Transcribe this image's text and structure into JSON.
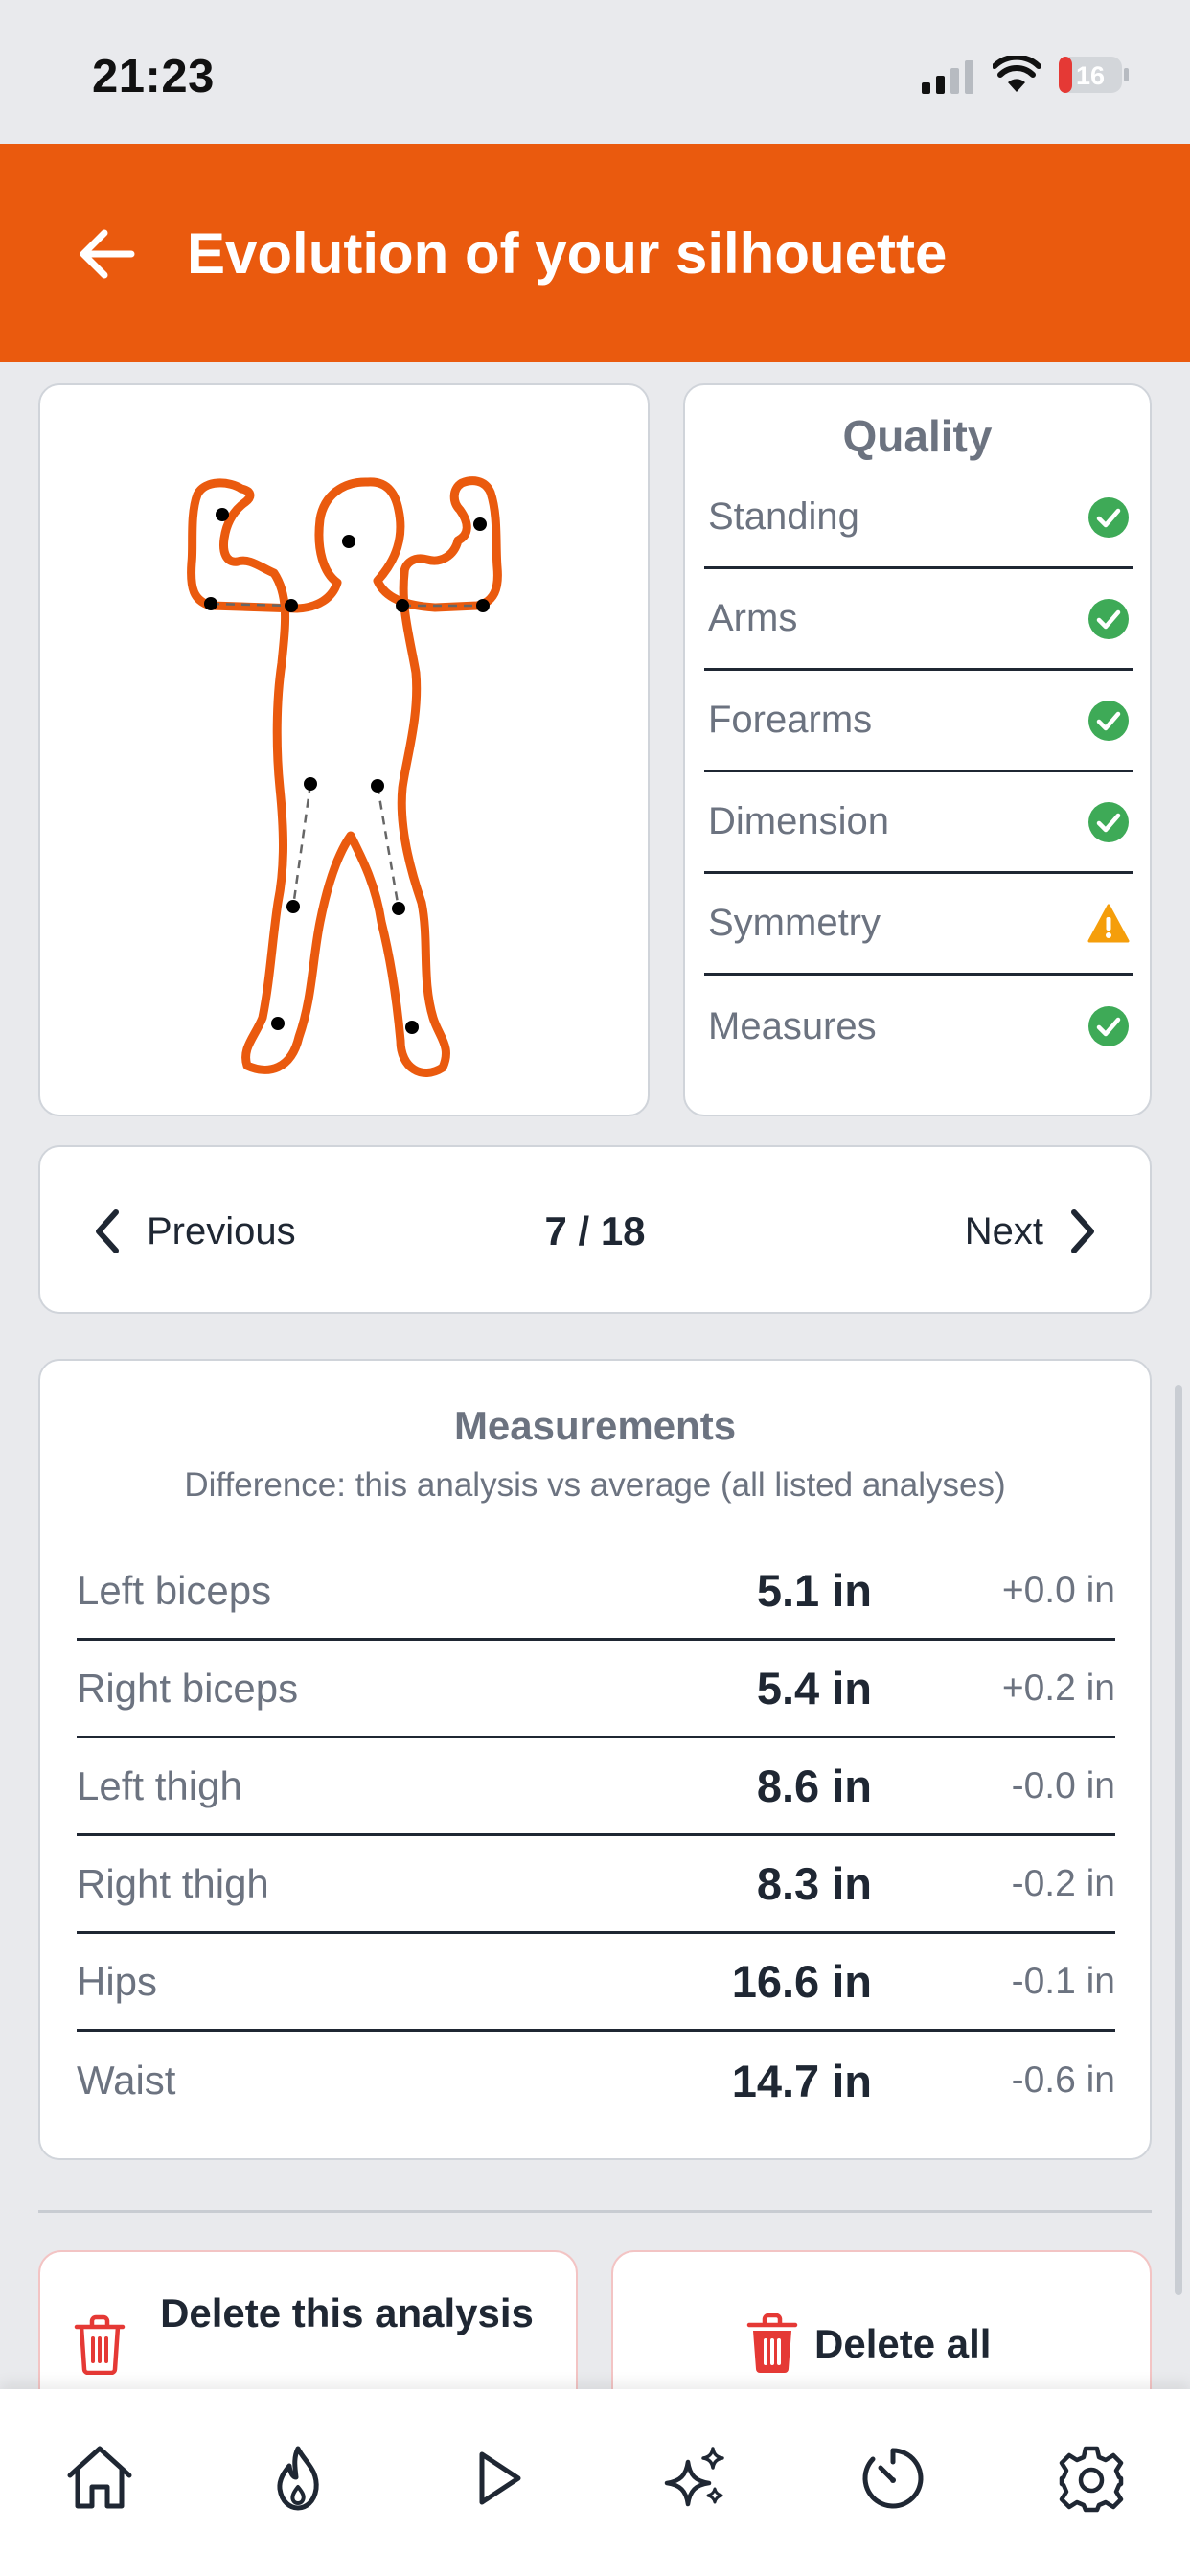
{
  "status_bar": {
    "time": "21:23",
    "battery": "16"
  },
  "header": {
    "title": "Evolution of your silhouette"
  },
  "quality": {
    "title": "Quality",
    "items": [
      {
        "label": "Standing",
        "status": "ok"
      },
      {
        "label": "Arms",
        "status": "ok"
      },
      {
        "label": "Forearms",
        "status": "ok"
      },
      {
        "label": "Dimension",
        "status": "ok"
      },
      {
        "label": "Symmetry",
        "status": "warning"
      },
      {
        "label": "Measures",
        "status": "ok"
      }
    ]
  },
  "pager": {
    "previous": "Previous",
    "count": "7 / 18",
    "next": "Next"
  },
  "measurements": {
    "title": "Measurements",
    "subtitle": "Difference: this analysis vs average (all listed analyses)",
    "rows": [
      {
        "label": "Left biceps",
        "value": "5.1 in",
        "diff": "+0.0 in"
      },
      {
        "label": "Right biceps",
        "value": "5.4 in",
        "diff": "+0.2 in"
      },
      {
        "label": "Left thigh",
        "value": "8.6 in",
        "diff": "-0.0 in"
      },
      {
        "label": "Right thigh",
        "value": "8.3 in",
        "diff": "-0.2 in"
      },
      {
        "label": "Hips",
        "value": "16.6 in",
        "diff": "-0.1 in"
      },
      {
        "label": "Waist",
        "value": "14.7 in",
        "diff": "-0.6 in"
      }
    ]
  },
  "actions": {
    "delete_one": "Delete this analysis",
    "delete_all": "Delete all"
  },
  "colors": {
    "accent": "#ea5a0e",
    "ok": "#3eaa57",
    "warning": "#f59e0b",
    "danger": "#e53935"
  },
  "tabs": [
    {
      "icon": "home-icon"
    },
    {
      "icon": "flame-icon"
    },
    {
      "icon": "play-icon"
    },
    {
      "icon": "sparkles-icon"
    },
    {
      "icon": "timer-icon"
    },
    {
      "icon": "settings-gear-icon"
    }
  ]
}
